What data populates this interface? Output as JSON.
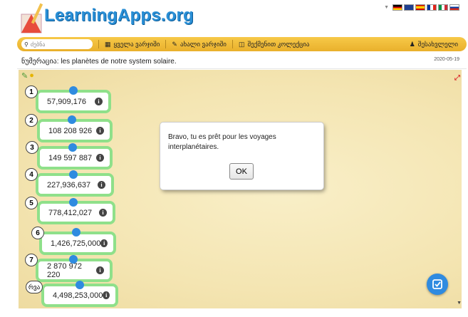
{
  "header": {
    "logo_text": "LearningApps.org"
  },
  "menu": {
    "search_placeholder": "ძებნა",
    "items": [
      {
        "label": "ყველა ვარჯიში",
        "icon": "grid-icon"
      },
      {
        "label": "ახალი ვარჯიში",
        "icon": "pencil-icon"
      },
      {
        "label": "შექმენით კოლექცია",
        "icon": "collection-icon"
      }
    ],
    "login_label": "შესახვლელი",
    "accent": "#f2bd3c"
  },
  "page": {
    "title": "ნუმერაცია: les planètes de notre system solaire.",
    "date": "2020-05-19"
  },
  "cards": [
    {
      "badge": "1",
      "value": "57,909,176"
    },
    {
      "badge": "2",
      "value": "108 208 926"
    },
    {
      "badge": "3",
      "value": "149 597 887"
    },
    {
      "badge": "4",
      "value": "227,936,637"
    },
    {
      "badge": "5",
      "value": "778,412,027"
    },
    {
      "badge": "6",
      "value": "1,426,725,000"
    },
    {
      "badge": "7",
      "value": "2 870 972 220"
    },
    {
      "badge": "რვა",
      "value": "4,498,253,000"
    }
  ],
  "dialog": {
    "message": "Bravo, tu es prêt pour les voyages interplanétaires.",
    "ok_label": "OK"
  },
  "colors": {
    "card_border": "#8fe08a",
    "pin": "#2f8be0"
  }
}
